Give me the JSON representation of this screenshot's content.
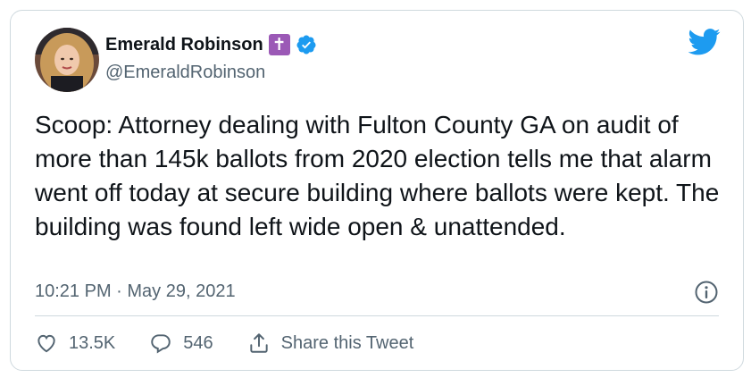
{
  "author": {
    "display_name": "Emerald Robinson",
    "handle": "@EmeraldRobinson",
    "name_badge": "✝",
    "verified": true
  },
  "tweet": {
    "text": "Scoop: Attorney dealing with Fulton County GA on audit of more than 145k ballots from 2020 election tells me that alarm went off today at secure building where ballots were kept. The building was found left wide open & unattended.",
    "timestamp": "10:21 PM · May 29, 2021"
  },
  "actions": {
    "likes": "13.5K",
    "replies": "546",
    "share_label": "Share this Tweet"
  },
  "colors": {
    "twitter_blue": "#1d9bf0",
    "secondary_text": "#536471",
    "badge_purple": "#9b59b6"
  }
}
